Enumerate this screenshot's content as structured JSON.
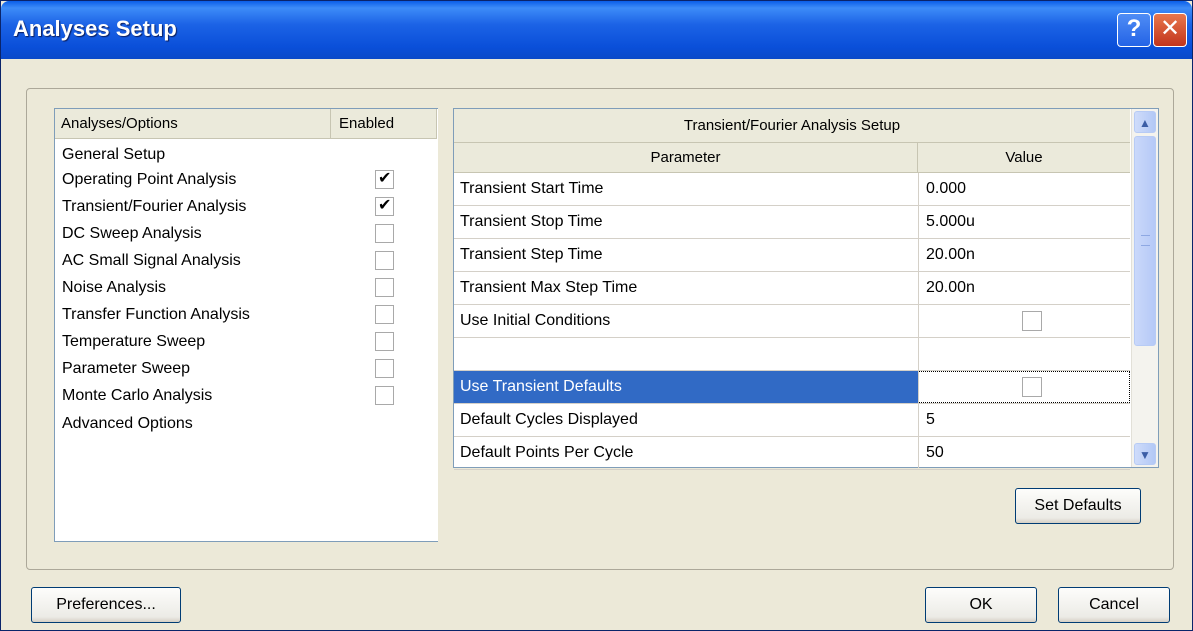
{
  "window": {
    "title": "Analyses Setup",
    "help_button": "?",
    "close_button": "✕"
  },
  "analyses_list": {
    "header_name": "Analyses/Options",
    "header_enabled": "Enabled",
    "items": [
      {
        "label": "General Setup",
        "has_checkbox": false
      },
      {
        "label": "Operating Point Analysis",
        "has_checkbox": true,
        "checked": true
      },
      {
        "label": "Transient/Fourier Analysis",
        "has_checkbox": true,
        "checked": true
      },
      {
        "label": "DC Sweep Analysis",
        "has_checkbox": true,
        "checked": false
      },
      {
        "label": "AC Small Signal Analysis",
        "has_checkbox": true,
        "checked": false
      },
      {
        "label": "Noise Analysis",
        "has_checkbox": true,
        "checked": false
      },
      {
        "label": "Transfer Function Analysis",
        "has_checkbox": true,
        "checked": false
      },
      {
        "label": "Temperature Sweep",
        "has_checkbox": true,
        "checked": false
      },
      {
        "label": "Parameter Sweep",
        "has_checkbox": true,
        "checked": false
      },
      {
        "label": "Monte Carlo Analysis",
        "has_checkbox": true,
        "checked": false
      },
      {
        "label": "Advanced Options",
        "has_checkbox": false
      }
    ]
  },
  "setup_grid": {
    "title": "Transient/Fourier Analysis Setup",
    "col_parameter": "Parameter",
    "col_value": "Value",
    "rows": [
      {
        "parameter": "Transient Start Time",
        "value": "0.000"
      },
      {
        "parameter": "Transient Stop Time",
        "value": "5.000u"
      },
      {
        "parameter": "Transient Step Time",
        "value": "20.00n"
      },
      {
        "parameter": "Transient Max Step Time",
        "value": "20.00n"
      },
      {
        "parameter": "Use Initial Conditions",
        "checkbox": true,
        "checked": false
      },
      {
        "parameter": "",
        "value": ""
      },
      {
        "parameter": "Use Transient Defaults",
        "checkbox": true,
        "checked": false,
        "selected": true
      },
      {
        "parameter": "Default Cycles Displayed",
        "value": "5"
      },
      {
        "parameter": "Default Points Per Cycle",
        "value": "50"
      }
    ]
  },
  "buttons": {
    "set_defaults": "Set Defaults",
    "preferences": "Preferences...",
    "ok": "OK",
    "cancel": "Cancel"
  }
}
